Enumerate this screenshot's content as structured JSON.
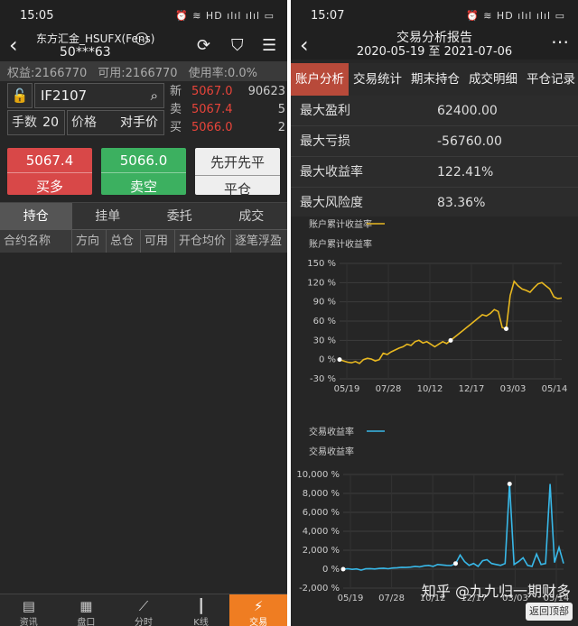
{
  "left": {
    "status_time": "15:05",
    "status_icons": "⏰ ≋ HD ılıl ılıl ▭",
    "account_name": "东方汇金_HSUFX(Fens)",
    "account_id": "50***63",
    "equity_label": "权益:2166770",
    "available_label": "可用:2166770",
    "usage_label": "使用率:0.0%",
    "symbol": "IF2107",
    "qty_label": "手数",
    "qty_value": "20",
    "price_label": "价格",
    "price_value": "对手价",
    "quotes": [
      {
        "label": "新",
        "price": "5067.0",
        "vol": "90623"
      },
      {
        "label": "卖",
        "price": "5067.4",
        "vol": "5"
      },
      {
        "label": "买",
        "price": "5066.0",
        "vol": "2"
      }
    ],
    "buy_price": "5067.4",
    "buy_label": "买多",
    "sell_price": "5066.0",
    "sell_label": "卖空",
    "close_price": "先开先平",
    "close_label": "平仓",
    "tabs": [
      "持仓",
      "挂单",
      "委托",
      "成交"
    ],
    "columns": [
      "合约名称",
      "方向",
      "总仓",
      "可用",
      "开仓均价",
      "逐笔浮盈"
    ],
    "nav": [
      {
        "icon": "▤",
        "label": "资讯"
      },
      {
        "icon": "▦",
        "label": "盘口"
      },
      {
        "icon": "⟋",
        "label": "分时"
      },
      {
        "icon": "┃",
        "label": "K线"
      },
      {
        "icon": "⚡",
        "label": "交易"
      }
    ]
  },
  "right": {
    "status_time": "15:07",
    "status_icons": "⏰ ≋ HD ılıl ılıl ▭",
    "title": "交易分析报告",
    "range": "2020-05-19 至 2021-07-06",
    "tabs": [
      "账户分析",
      "交易统计",
      "期末持仓",
      "成交明细",
      "平仓记录"
    ],
    "stats": [
      {
        "label": "最大盈利",
        "value": "62400.00"
      },
      {
        "label": "最大亏损",
        "value": "-56760.00"
      },
      {
        "label": "最大收益率",
        "value": "122.41%"
      },
      {
        "label": "最大风险度",
        "value": "83.36%"
      }
    ],
    "watermark": "知乎 @九九归一期财多",
    "feedback": "返回顶部"
  },
  "chart_data": [
    {
      "type": "line",
      "legend": "账户累计收益率",
      "title": "账户累计收益率",
      "color": "#e8b820",
      "x_ticks": [
        "05/19",
        "07/28",
        "10/12",
        "12/17",
        "03/03",
        "05/14"
      ],
      "y_ticks": [
        "150 %",
        "120 %",
        "90 %",
        "60 %",
        "30 %",
        "0 %",
        "-30 %"
      ],
      "ylim": [
        -30,
        150
      ],
      "values": [
        0,
        -2,
        -4,
        -5,
        -3,
        -6,
        0,
        2,
        1,
        -2,
        0,
        10,
        8,
        12,
        15,
        18,
        20,
        24,
        22,
        28,
        30,
        26,
        28,
        24,
        20,
        24,
        28,
        25,
        30,
        35,
        40,
        45,
        50,
        55,
        60,
        65,
        70,
        68,
        72,
        78,
        75,
        50,
        48,
        100,
        122,
        115,
        110,
        108,
        105,
        112,
        118,
        120,
        115,
        110,
        98,
        95,
        96
      ]
    },
    {
      "type": "line",
      "legend": "交易收益率",
      "title": "交易收益率",
      "color": "#38b8e8",
      "x_ticks": [
        "05/19",
        "07/28",
        "10/12",
        "12/17",
        "03/03",
        "05/14"
      ],
      "y_ticks": [
        "10,000 %",
        "8,000 %",
        "6,000 %",
        "4,000 %",
        "2,000 %",
        "0 %",
        "-2,000 %"
      ],
      "ylim": [
        -2000,
        10000
      ],
      "values": [
        0,
        50,
        -20,
        30,
        -100,
        40,
        60,
        20,
        80,
        100,
        50,
        120,
        150,
        200,
        180,
        220,
        300,
        250,
        350,
        400,
        300,
        500,
        450,
        400,
        380,
        600,
        1500,
        800,
        400,
        600,
        300,
        900,
        1000,
        600,
        500,
        400,
        600,
        9000,
        500,
        800,
        1200,
        400,
        300,
        1600,
        500,
        600,
        9000,
        700,
        2300,
        600
      ]
    }
  ]
}
